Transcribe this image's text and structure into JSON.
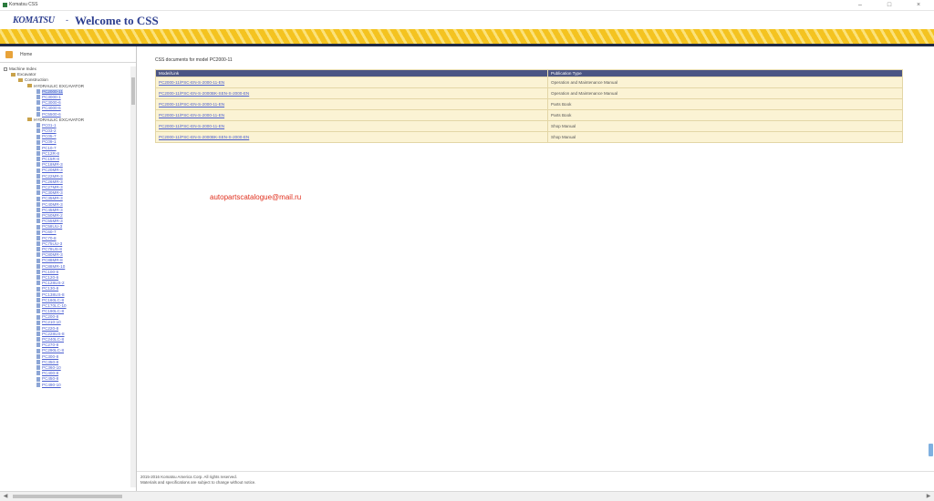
{
  "window": {
    "title": "Komatsu CSS"
  },
  "header": {
    "brand": "KOMATSU",
    "separator": "-",
    "title": "Welcome to CSS"
  },
  "sidebar": {
    "home_label": "Home",
    "tree": [
      {
        "level": 0,
        "type": "root",
        "label": "Machine Index"
      },
      {
        "level": 1,
        "type": "folder",
        "label": "Excavator"
      },
      {
        "level": 2,
        "type": "folder",
        "label": "Construction"
      },
      {
        "level": 3,
        "type": "folder",
        "label": "HYDRAULIC EXCAVATOR"
      },
      {
        "level": 4,
        "type": "link",
        "label": "PC2000-11"
      },
      {
        "level": 4,
        "type": "link",
        "label": "PC3000-1"
      },
      {
        "level": 4,
        "type": "link",
        "label": "PC3000-6"
      },
      {
        "level": 4,
        "type": "link",
        "label": "PC4000-6"
      },
      {
        "level": 4,
        "type": "link",
        "label": "PC5500-6"
      },
      {
        "level": 3,
        "type": "folder",
        "label": "HYDRAULIC EXCAVATOR"
      },
      {
        "level": 4,
        "type": "link",
        "label": "PC01-1"
      },
      {
        "level": 4,
        "type": "link",
        "label": "PC03-2"
      },
      {
        "level": 4,
        "type": "link",
        "label": "PC05-7"
      },
      {
        "level": 4,
        "type": "link",
        "label": "PC09-1"
      },
      {
        "level": 4,
        "type": "link",
        "label": "PC10-7"
      },
      {
        "level": 4,
        "type": "link",
        "label": "PC12R-8"
      },
      {
        "level": 4,
        "type": "link",
        "label": "PC15R-8"
      },
      {
        "level": 4,
        "type": "link",
        "label": "PC18MR-3"
      },
      {
        "level": 4,
        "type": "link",
        "label": "PC20MR-3"
      },
      {
        "level": 4,
        "type": "link",
        "label": "PC22MR-3"
      },
      {
        "level": 4,
        "type": "link",
        "label": "PC26MR-3"
      },
      {
        "level": 4,
        "type": "link",
        "label": "PC27MR-3"
      },
      {
        "level": 4,
        "type": "link",
        "label": "PC30MR-3"
      },
      {
        "level": 4,
        "type": "link",
        "label": "PC35MR-3"
      },
      {
        "level": 4,
        "type": "link",
        "label": "PC40MR-3"
      },
      {
        "level": 4,
        "type": "link",
        "label": "PC45MR-3"
      },
      {
        "level": 4,
        "type": "link",
        "label": "PC50MR-2"
      },
      {
        "level": 4,
        "type": "link",
        "label": "PC55MR-3"
      },
      {
        "level": 4,
        "type": "link",
        "label": "PC58UU-3"
      },
      {
        "level": 4,
        "type": "link",
        "label": "PC60-7"
      },
      {
        "level": 4,
        "type": "link",
        "label": "PC70-8"
      },
      {
        "level": 4,
        "type": "link",
        "label": "PC75UU-3"
      },
      {
        "level": 4,
        "type": "link",
        "label": "PC78US-8"
      },
      {
        "level": 4,
        "type": "link",
        "label": "PC80MR-3"
      },
      {
        "level": 4,
        "type": "link",
        "label": "PC88MR-8"
      },
      {
        "level": 4,
        "type": "link",
        "label": "PC88MR-10"
      },
      {
        "level": 4,
        "type": "link",
        "label": "PC100-6"
      },
      {
        "level": 4,
        "type": "link",
        "label": "PC120-6"
      },
      {
        "level": 4,
        "type": "link",
        "label": "PC128US-2"
      },
      {
        "level": 4,
        "type": "link",
        "label": "PC130-8"
      },
      {
        "level": 4,
        "type": "link",
        "label": "PC138US-8"
      },
      {
        "level": 4,
        "type": "link",
        "label": "PC160LC-8"
      },
      {
        "level": 4,
        "type": "link",
        "label": "PC170LC-10"
      },
      {
        "level": 4,
        "type": "link",
        "label": "PC190LC-8"
      },
      {
        "level": 4,
        "type": "link",
        "label": "PC200-8"
      },
      {
        "level": 4,
        "type": "link",
        "label": "PC210-10"
      },
      {
        "level": 4,
        "type": "link",
        "label": "PC220-8"
      },
      {
        "level": 4,
        "type": "link",
        "label": "PC228US-8"
      },
      {
        "level": 4,
        "type": "link",
        "label": "PC240LC-8"
      },
      {
        "level": 4,
        "type": "link",
        "label": "PC270-8"
      },
      {
        "level": 4,
        "type": "link",
        "label": "PC290LC-8"
      },
      {
        "level": 4,
        "type": "link",
        "label": "PC300-8"
      },
      {
        "level": 4,
        "type": "link",
        "label": "PC350-8"
      },
      {
        "level": 4,
        "type": "link",
        "label": "PC360-10"
      },
      {
        "level": 4,
        "type": "link",
        "label": "PC400-8"
      },
      {
        "level": 4,
        "type": "link",
        "label": "PC450-8"
      },
      {
        "level": 4,
        "type": "link",
        "label": "PC490-10"
      }
    ]
  },
  "main": {
    "heading": "CSS documents for model PC2000-11",
    "columns": [
      "Model/Link",
      "Publication Type"
    ],
    "rows": [
      {
        "link": "PC2000-11/PSC-EN-S-2000-11-EN",
        "type": "Operation and Maintenance Manual"
      },
      {
        "link": "PC2000-11/PSC-EN-S-2000BK-SEN-S-2000-EN",
        "type": "Operation and Maintenance Manual"
      },
      {
        "link": "PC2000-11/PSC-EN-S-2000-11-EN",
        "type": "Parts Book"
      },
      {
        "link": "PC2000-11/PSC-EN-S-2000-11-EN",
        "type": "Parts Book"
      },
      {
        "link": "PC2000-11/PSC-EN-S-2000-11-EN",
        "type": "Shop Manual"
      },
      {
        "link": "PC2000-11/PSC-EN-S-2000BK-SEN-S-2000-EN",
        "type": "Shop Manual"
      }
    ],
    "watermark": "autopartscatalogue@mail.ru"
  },
  "footer": {
    "line1": "2015-2016 Komatsu America Corp. All rights reserved.",
    "line2": "Materials and specifications are subject to change without notice."
  },
  "colors": {
    "brand_blue": "#2c3e8f",
    "stripe_yellow": "#f4c320",
    "table_header": "#4b5584",
    "table_row": "#fbf3d4",
    "watermark_red": "#e0301e"
  }
}
